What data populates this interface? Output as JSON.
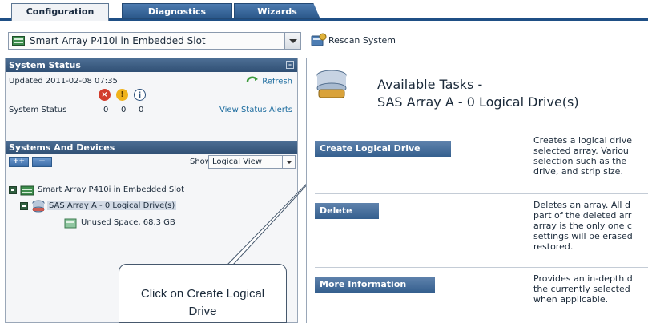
{
  "tabs": [
    {
      "label": "Configuration",
      "active": true
    },
    {
      "label": "Diagnostics",
      "active": false
    },
    {
      "label": "Wizards",
      "active": false
    }
  ],
  "controller": {
    "selected": "Smart Array P410i in Embedded Slot"
  },
  "toolbar": {
    "rescan_label": "Rescan System"
  },
  "system_status": {
    "header": "System Status",
    "updated": "Updated 2011-02-08 07:35",
    "refresh_label": "Refresh",
    "row_label": "System Status",
    "counts": [
      "0",
      "0",
      "0"
    ],
    "view_alerts": "View Status Alerts"
  },
  "systems_devices": {
    "header": "Systems And Devices",
    "expand_label": "++",
    "collapse_label": "--",
    "show_label": "Show",
    "show_value": "Logical View",
    "tree": [
      {
        "label": "Smart Array P410i in Embedded Slot"
      },
      {
        "label": "SAS Array A - 0 Logical Drive(s)"
      },
      {
        "label": "Unused Space, 68.3 GB"
      }
    ]
  },
  "callout": {
    "line1": "Click on Create Logical",
    "line2": "Drive"
  },
  "tasks": {
    "title": "Available Tasks -",
    "subtitle": "SAS Array A - 0 Logical Drive(s)",
    "items": [
      {
        "button": "Create Logical Drive",
        "desc": [
          "Creates a logical drive",
          "selected array. Variou",
          "selection such as the",
          "drive, and strip size."
        ]
      },
      {
        "button": "Delete",
        "desc": [
          "Deletes an array. All d",
          "part of the deleted arr",
          "array is the only one c",
          "settings will be erased",
          "restored."
        ]
      },
      {
        "button": "More Information",
        "desc": [
          "Provides an in-depth d",
          "the currently selected",
          "when applicable."
        ]
      }
    ]
  },
  "colors": {
    "accent": "#1f4f85",
    "header": "#304f74",
    "button": "#355f8e",
    "link": "#1b6b9e"
  }
}
